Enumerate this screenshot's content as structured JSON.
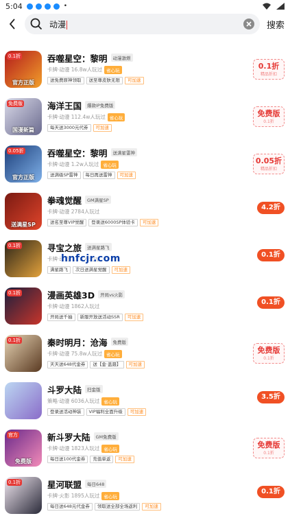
{
  "status_bar": {
    "time": "5:04",
    "dot": "•"
  },
  "search": {
    "query": "动漫",
    "action_label": "搜索"
  },
  "watermark": "hnfcjr.com",
  "games": [
    {
      "name": "吞噬星空：黎明",
      "subtag": "动漫激燃",
      "meta": "卡牌·动漫  16.8w人玩过",
      "tag": "省心玩",
      "promos": [
        "送免费原神领取",
        "送至尊皮肤无限"
      ],
      "promo_extra": "可加速",
      "price_style": "outline",
      "price_main": "0.1折",
      "price_sub": "精品折扣",
      "icon_badge": "0.1折",
      "icon_caption": "官方正版",
      "icon_colors": [
        "#b31b1b",
        "#f2a02b"
      ]
    },
    {
      "name": "海洋王国",
      "subtag": "爆款IP免费版",
      "meta": "卡牌·动漫  112.4w人玩过",
      "tag": "省心玩",
      "promos": [
        "每天送3000元代券"
      ],
      "promo_extra": "可加速",
      "price_style": "outline",
      "price_main": "免费版",
      "price_sub": "0.1折",
      "icon_badge": "免费版",
      "icon_caption": "国漫新篇",
      "icon_colors": [
        "#d9d9e8",
        "#6b6b8f"
      ]
    },
    {
      "name": "吞噬星空：黎明",
      "subtag": "送满星雷神",
      "meta": "卡牌·动漫  1.2w人玩过",
      "tag": "省心玩",
      "promos": [
        "送满级SP雷神",
        "每日再送雷神"
      ],
      "promo_extra": "可加速",
      "price_style": "outline",
      "price_main": "0.05折",
      "price_sub": "精品折扣",
      "icon_badge": "0.05折",
      "icon_caption": "官方正版",
      "icon_colors": [
        "#1d3f7a",
        "#7fb0e8"
      ]
    },
    {
      "name": "拳魂觉醒",
      "subtag": "GM满星SP",
      "meta": "卡牌·动漫  2784人玩过",
      "tag": "",
      "promos": [
        "送名至尊VIP觉醒",
        "登录送6000SP体验卡"
      ],
      "promo_extra": "可加速",
      "price_style": "pill",
      "price_main": "4.2折",
      "price_sub": "",
      "icon_badge": "",
      "icon_caption": "送满星SP",
      "icon_colors": [
        "#7a1a12",
        "#e0452b"
      ]
    },
    {
      "name": "寻宝之旅",
      "subtag": "送满星路飞",
      "meta": "卡牌·动漫  1.2w人玩过",
      "tag": "",
      "promos": [
        "满星路飞",
        "次日送满星觉醒"
      ],
      "promo_extra": "可加速",
      "price_style": "pill",
      "price_main": "0.1折",
      "price_sub": "",
      "icon_badge": "0.1折",
      "icon_caption": "",
      "icon_colors": [
        "#2b2418",
        "#e3a23c"
      ]
    },
    {
      "name": "漫画英雄3D",
      "subtag": "开局vs火影",
      "meta": "卡牌·动漫  1862人玩过",
      "tag": "",
      "promos": [
        "开局送千抽",
        "新服开放送活动SSR"
      ],
      "promo_extra": "可加速",
      "price_style": "pill",
      "price_main": "0.1折",
      "price_sub": "",
      "icon_badge": "0.1折",
      "icon_caption": "",
      "icon_colors": [
        "#1c1f3d",
        "#c8352b"
      ]
    },
    {
      "name": "秦时明月：沧海",
      "subtag": "免费版",
      "meta": "卡牌·动漫  75.8w人玩过",
      "tag": "省心玩",
      "promos": [
        "天天送648代金券",
        "送【金·盖聂】"
      ],
      "promo_extra": "可加速",
      "price_style": "outline",
      "price_main": "免费版",
      "price_sub": "0.1折",
      "icon_badge": "0.1折",
      "icon_caption": "",
      "icon_colors": [
        "#e6d3b3",
        "#5a3a22"
      ]
    },
    {
      "name": "斗罗大陆",
      "subtag": "扫金版",
      "meta": "策略·动漫  6036人玩过",
      "tag": "省心玩",
      "promos": [
        "登录送活动神装",
        "VIP福利全面升级"
      ],
      "promo_extra": "可加速",
      "price_style": "pill",
      "price_main": "3.5折",
      "price_sub": "",
      "icon_badge": "",
      "icon_caption": "",
      "icon_colors": [
        "#bcd7f2",
        "#8a6cc9"
      ]
    },
    {
      "name": "新斗罗大陆",
      "subtag": "GM免费版",
      "meta": "卡牌·动漫  1823人玩过",
      "tag": "省心玩",
      "promos": [
        "每日送100代金券",
        "充值单返"
      ],
      "promo_extra": "可加速",
      "price_style": "outline",
      "price_main": "免费版",
      "price_sub": "0.1折",
      "icon_badge": "官方",
      "icon_caption": "免费版",
      "icon_colors": [
        "#6a2a8a",
        "#f28bb8"
      ]
    },
    {
      "name": "星河联盟",
      "subtag": "每日648",
      "meta": "卡牌·火影  1895人玩过",
      "tag": "省心玩",
      "promos": [
        "每日送648元代金券",
        "领取送全部全场返利"
      ],
      "promo_extra": "可加速",
      "price_style": "pill",
      "price_main": "0.1折",
      "price_sub": "",
      "icon_badge": "0.1折",
      "icon_caption": "",
      "icon_colors": [
        "#f0e6ef",
        "#2b2b3a"
      ]
    }
  ],
  "colors": {
    "accent": "#f05024",
    "tag_orange": "#ffae3b",
    "outline_red": "#e53935"
  }
}
